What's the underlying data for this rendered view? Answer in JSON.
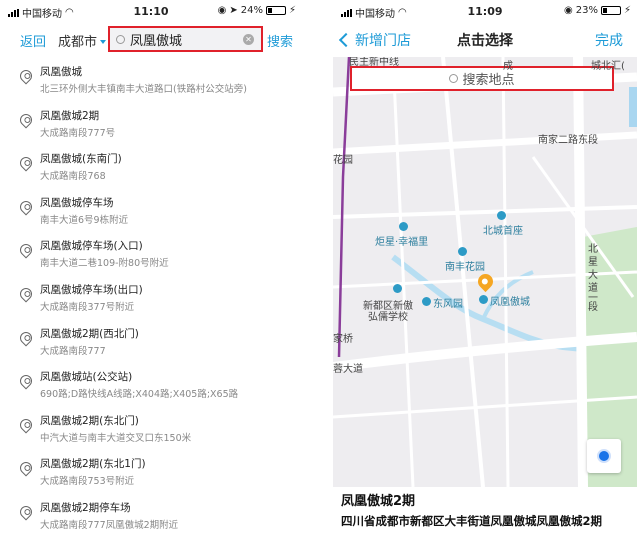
{
  "left": {
    "status": {
      "carrier": "中国移动",
      "time": "11:10",
      "battery": "24%",
      "battery_level": 0.24
    },
    "nav": {
      "back": "返回",
      "city": "成都市",
      "search_value": "凤凰傲城",
      "search_action": "搜索"
    },
    "results": [
      {
        "name": "凤凰傲城",
        "address": "北三环外侧大丰镇南丰大道路口(铁路村公交站旁)"
      },
      {
        "name": "凤凰傲城2期",
        "address": "大成路南段777号"
      },
      {
        "name": "凤凰傲城(东南门)",
        "address": "大成路南段768"
      },
      {
        "name": "凤凰傲城停车场",
        "address": "南丰大道6号9栋附近"
      },
      {
        "name": "凤凰傲城停车场(入口)",
        "address": "南丰大道二巷109-附80号附近"
      },
      {
        "name": "凤凰傲城停车场(出口)",
        "address": "大成路南段377号附近"
      },
      {
        "name": "凤凰傲城2期(西北门)",
        "address": "大成路南段777"
      },
      {
        "name": "凤凰傲城站(公交站)",
        "address": "690路;D路快线A线路;X404路;X405路;X65路"
      },
      {
        "name": "凤凰傲城2期(东北门)",
        "address": "中汽大道与南丰大道交叉口东150米"
      },
      {
        "name": "凤凰傲城2期(东北1门)",
        "address": "大成路南段753号附近"
      },
      {
        "name": "凤凰傲城2期停车场",
        "address": "大成路南段777凤凰傲城2期附近"
      }
    ]
  },
  "right": {
    "status": {
      "carrier": "中国移动",
      "time": "11:09",
      "battery": "23%",
      "battery_level": 0.23
    },
    "nav": {
      "back": "新增门店",
      "title": "点击选择",
      "done": "完成"
    },
    "map": {
      "search_placeholder": "搜索地点",
      "labels": {
        "top_road": "民主新中线",
        "cheng": "成",
        "top_right": "城北汇(",
        "nanjia_road": "南家二路东段",
        "huayuan": "花园",
        "juxing": "炬星·幸福里",
        "beicheng": "北城首座",
        "nanfeng_garden": "南丰花园",
        "xindu_school_1": "新都区新傲",
        "xindu_school_2": "弘儒学校",
        "dongfeng": "东风园",
        "fenghuang": "凤凰傲城",
        "beixing_1": "北",
        "beixing_2": "星",
        "beixing_3": "大",
        "beixing_4": "道",
        "beixing_5": "一",
        "beixing_6": "段",
        "jiaqiao": "家桥",
        "rongdadao": "蓉大道"
      }
    },
    "info": {
      "title": "凤凰傲城2期",
      "address": "四川省成都市新都区大丰街道凤凰傲城凤凰傲城2期"
    }
  }
}
